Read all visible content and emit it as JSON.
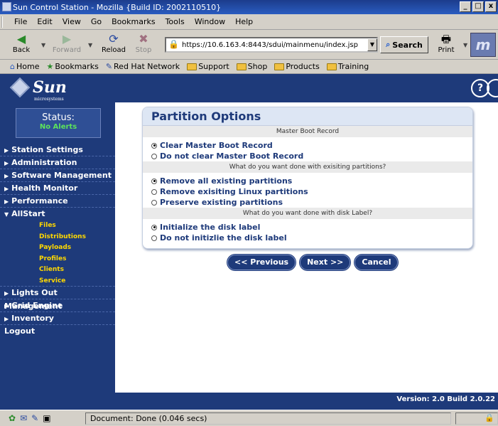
{
  "window": {
    "title": "Sun Control Station - Mozilla {Build ID: 2002110510}",
    "minimize": "_",
    "maximize": "□",
    "close": "x"
  },
  "menu": [
    "File",
    "Edit",
    "View",
    "Go",
    "Bookmarks",
    "Tools",
    "Window",
    "Help"
  ],
  "toolbar": {
    "back": "Back",
    "forward": "Forward",
    "reload": "Reload",
    "stop": "Stop",
    "url": "https://10.6.163.4:8443/sdui/mainmenu/index.jsp",
    "search": "Search",
    "print": "Print"
  },
  "personal": [
    "Home",
    "Bookmarks",
    "Red Hat Network",
    "Support",
    "Shop",
    "Products",
    "Training"
  ],
  "brand": {
    "logo": "Sun",
    "sub": "microsystems",
    "help": "?"
  },
  "status": {
    "label": "Status:",
    "value": "No Alerts"
  },
  "nav": {
    "station_settings": "Station Settings",
    "administration": "Administration",
    "software_management": "Software Management",
    "health_monitor": "Health Monitor",
    "performance": "Performance",
    "allstart": "AllStart",
    "allstart_sub": [
      "Files",
      "Distributions",
      "Payloads",
      "Profiles",
      "Clients",
      "Service"
    ],
    "lights_out": "Lights Out Management",
    "grid_engine": "Grid Engine",
    "inventory": "Inventory",
    "logout": "Logout"
  },
  "panel": {
    "title": "Partition Options",
    "section1": "Master Boot Record",
    "mbr_clear": "Clear Master Boot Record",
    "mbr_keep": "Do not clear Master Boot Record",
    "section2": "What do you want done with exisiting partitions?",
    "part_remove_all": "Remove all existing partitions",
    "part_remove_linux": "Remove exisiting Linux partitions",
    "part_preserve": "Preserve existing partitions",
    "section3": "What do you want done with disk Label?",
    "label_init": "Initialize the disk label",
    "label_keep": "Do not initizlie the disk label"
  },
  "buttons": {
    "previous": "<< Previous",
    "next": "Next >>",
    "cancel": "Cancel"
  },
  "version": "Version: 2.0 Build 2.0.22",
  "statusbar": {
    "text": "Document: Done (0.046 secs)"
  },
  "colors": {
    "brand_navy": "#1e3a7a",
    "alert_green": "#5ce25c",
    "sub_yellow": "#ffd800"
  }
}
